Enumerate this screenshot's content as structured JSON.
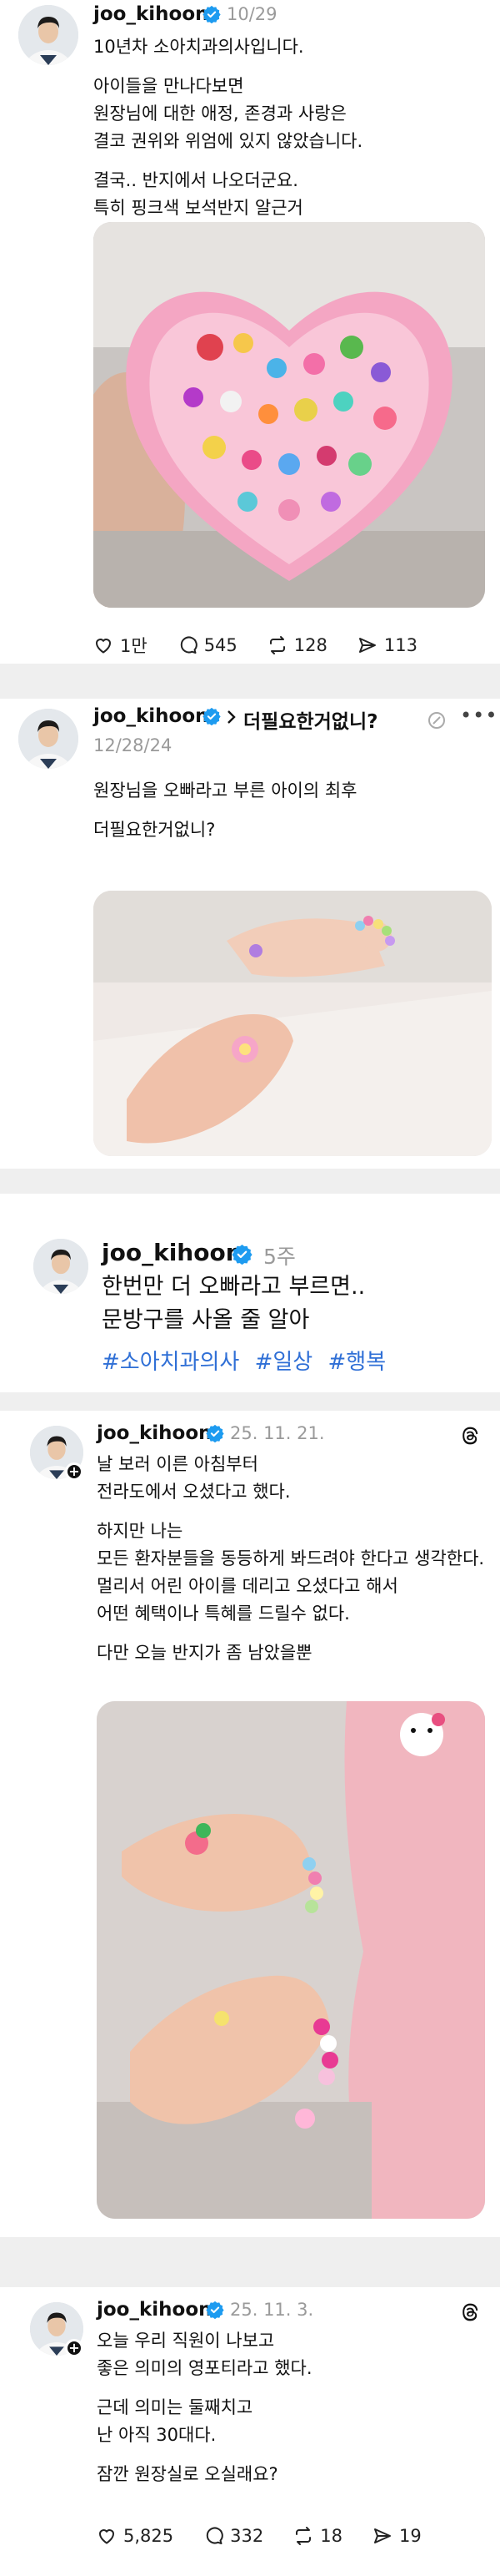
{
  "posts": [
    {
      "username": "joo_kihoon",
      "time": "10/29",
      "lines": [
        "10년차 소아치과의사입니다."
      ],
      "para2": [
        "아이들을 만나다보면",
        "원장님에 대한 애정, 존경과 사랑은",
        "결코 권위와 위엄에 있지 않았습니다."
      ],
      "para3": [
        "결국.. 반지에서 나오더군요.",
        "특히 핑크색 보석반지 알근거"
      ],
      "stats": {
        "likes": "1만",
        "comments": "545",
        "reposts": "128",
        "shares": "113"
      }
    },
    {
      "username": "joo_kihoon",
      "reply_to": "더필요한거없니?",
      "time": "12/28/24",
      "para1": [
        "원장님을 오빠라고 부른 아이의 최후"
      ],
      "para2": [
        "더필요한거없니?"
      ]
    },
    {
      "username": "joo_kihoon",
      "time": "5주",
      "lines": [
        "한번만 더 오빠라고 부르면..",
        "문방구를 사올 줄 알아"
      ],
      "tags": [
        "#소아치과의사",
        "#일상",
        "#행복"
      ]
    },
    {
      "username": "joo_kihoon",
      "time": "25. 11. 21.",
      "para1": [
        "날 보러 이른 아침부터",
        "전라도에서 오셨다고 했다."
      ],
      "para2": [
        "하지만 나는",
        "모든 환자분들을 동등하게 봐드려야 한다고 생각한다.",
        "멀리서 어린 아이를 데리고 오셨다고 해서",
        "어떤 혜택이나 특혜를 드릴수 없다."
      ],
      "para3": [
        "다만 오늘 반지가 좀 남았을뿐"
      ]
    },
    {
      "username": "joo_kihoon",
      "time": "25. 11. 3.",
      "para1": [
        "오늘 우리 직원이 나보고",
        "좋은 의미의 영포티라고 했다."
      ],
      "para2": [
        "근데 의미는 둘째치고",
        "난 아직 30대다."
      ],
      "para3": [
        "잠깐 원장실로 오실래요?"
      ],
      "stats": {
        "likes": "5,825",
        "comments": "332",
        "reposts": "18",
        "shares": "19"
      }
    }
  ],
  "icons": {
    "verified": "verified-badge-icon",
    "like": "heart-icon",
    "comment": "comment-bubble-icon",
    "repost": "repost-icon",
    "share": "send-icon",
    "threads": "threads-logo-icon",
    "more": "more-options-icon",
    "chevron": "chevron-right-icon",
    "pin": "pin-icon"
  },
  "colors": {
    "verified": "#1d9bf0",
    "tag": "#2f6fd6",
    "muted": "#9a9a9a",
    "gap": "#efefef"
  }
}
